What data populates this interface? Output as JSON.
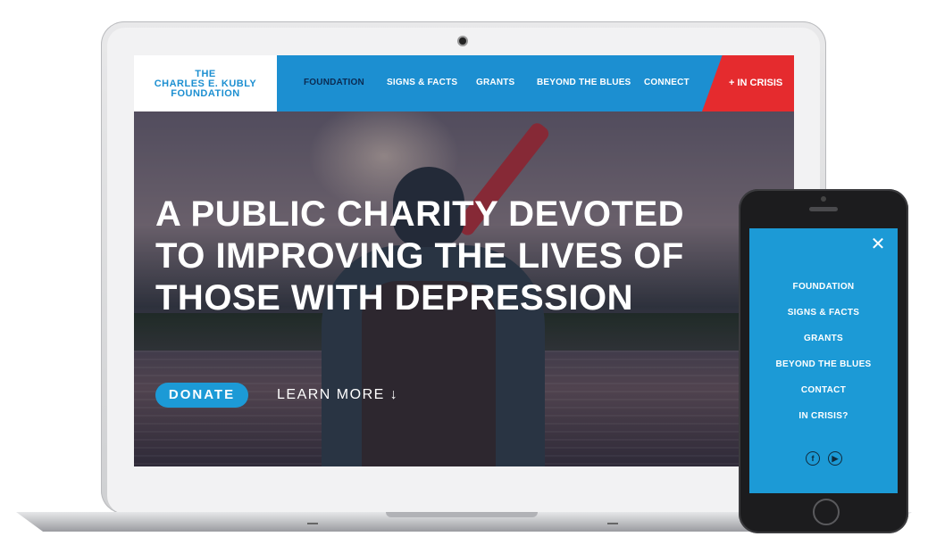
{
  "site": {
    "logo_lines": [
      "THE",
      "CHARLES E. KUBLY",
      "FOUNDATION"
    ]
  },
  "nav": {
    "items": [
      "FOUNDATION",
      "SIGNS & FACTS",
      "GRANTS",
      "BEYOND THE BLUES",
      "CONNECT"
    ],
    "active": "FOUNDATION",
    "crisis_label": "+ IN CRISIS"
  },
  "hero": {
    "headline_lines": [
      "A PUBLIC CHARITY DEVOTED",
      "TO IMPROVING THE LIVES OF",
      "THOSE WITH DEPRESSION"
    ],
    "donate_label": "DONATE",
    "learn_more_label": "LEARN MORE ↓"
  },
  "mobile": {
    "close_icon": "close-icon",
    "menu_items": [
      "FOUNDATION",
      "SIGNS & FACTS",
      "GRANTS",
      "BEYOND THE BLUES",
      "CONTACT",
      "IN CRISIS?"
    ],
    "social_icons": [
      "facebook-icon",
      "youtube-icon"
    ]
  },
  "colors": {
    "brand_blue": "#1c8fd1",
    "crisis_red": "#e52b2e",
    "nav_active": "#0b2b52",
    "mobile_menu_bg": "#1c9ad6"
  }
}
